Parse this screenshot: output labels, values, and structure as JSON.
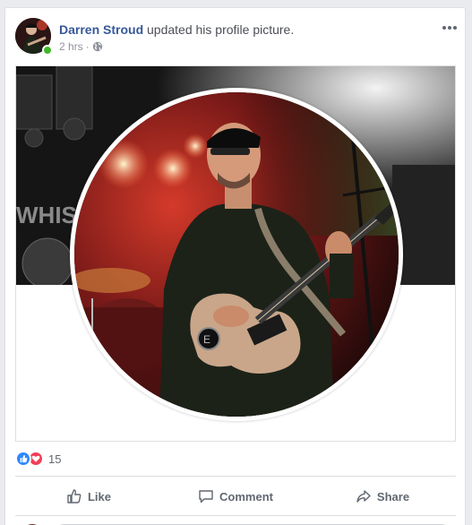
{
  "post": {
    "author": "Darren Stroud",
    "action": " updated his profile picture.",
    "time": "2 hrs",
    "separator": "·",
    "privacy_icon": "globe-icon"
  },
  "reactions": {
    "count": "15",
    "types": [
      "like",
      "love"
    ]
  },
  "actions": {
    "like_label": "Like",
    "comment_label": "Comment",
    "share_label": "Share"
  },
  "colors": {
    "link": "#365899",
    "online": "#42b72a",
    "like": "#2d88ff",
    "love": "#f33e58"
  }
}
